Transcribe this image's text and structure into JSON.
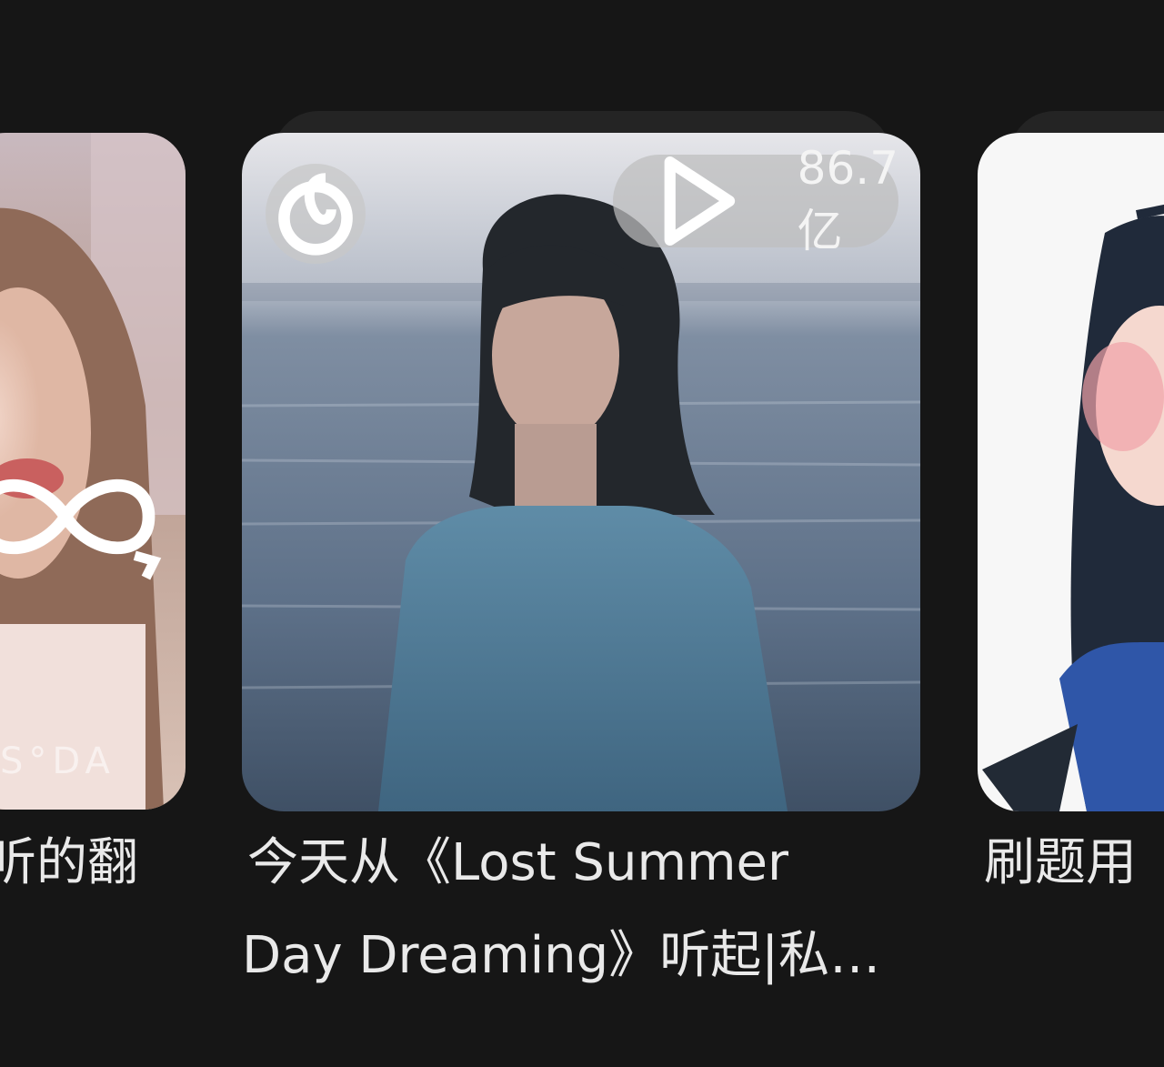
{
  "cards": [
    {
      "title": "听的翻",
      "watermark": "S°DA",
      "icon": "loop-icon"
    },
    {
      "title_line1": "今天从《Lost Summer",
      "title_line2": "Day Dreaming》听起|私…",
      "play_count": "86.7亿",
      "icons": [
        "netease-logo-icon",
        "play-icon"
      ]
    },
    {
      "title": "刷题用"
    }
  ]
}
